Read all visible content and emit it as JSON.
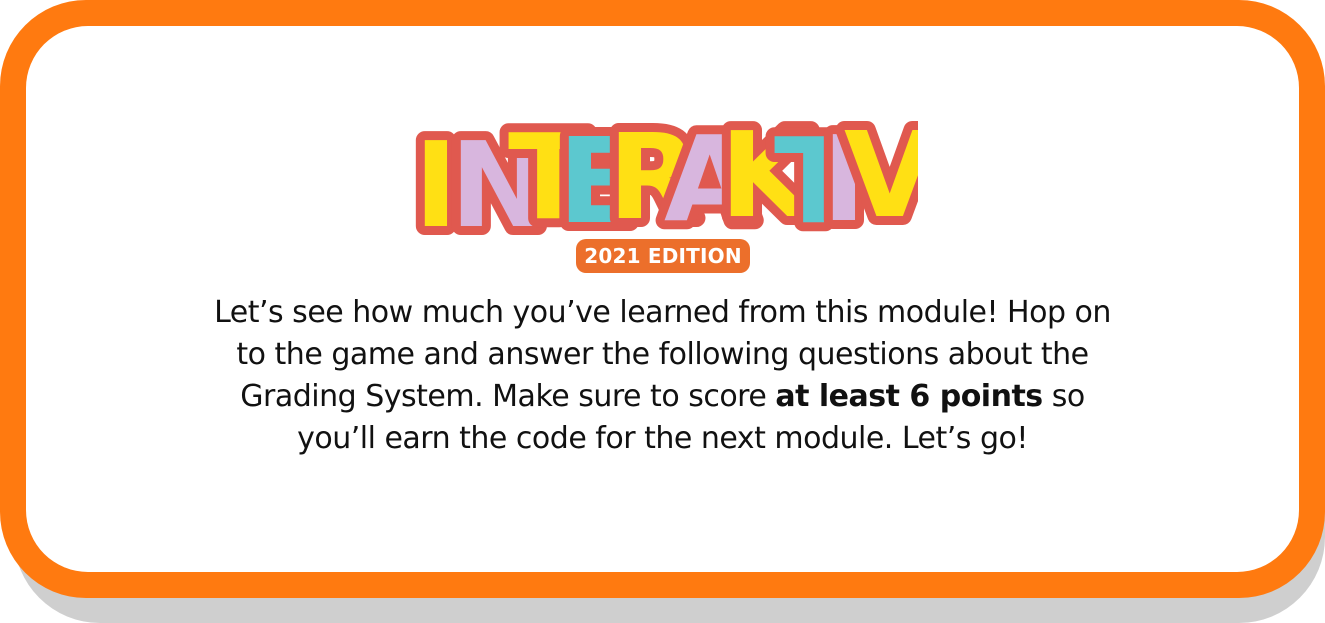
{
  "logo": {
    "letters": [
      "I",
      "N",
      "T",
      "E",
      "R",
      "A",
      "K",
      "T",
      "I",
      "V"
    ],
    "colors": {
      "outline": "#e0594f",
      "yellow": "#ffe014",
      "lavender": "#d8b6de",
      "teal": "#5cc8cf"
    },
    "edition_badge": "2021 EDITION"
  },
  "message": {
    "part1": "Let’s see how much you’ve learned from this module! Hop on to the game and answer the following questions about the Grading System. Make sure to score ",
    "bold": "at least 6 points",
    "part2": " so you’ll earn the code for the next module. Let’s go!"
  },
  "theme": {
    "frame_color": "#ff7a10",
    "shadow_color": "#cfcfcf",
    "badge_color": "#ec6f2b"
  }
}
